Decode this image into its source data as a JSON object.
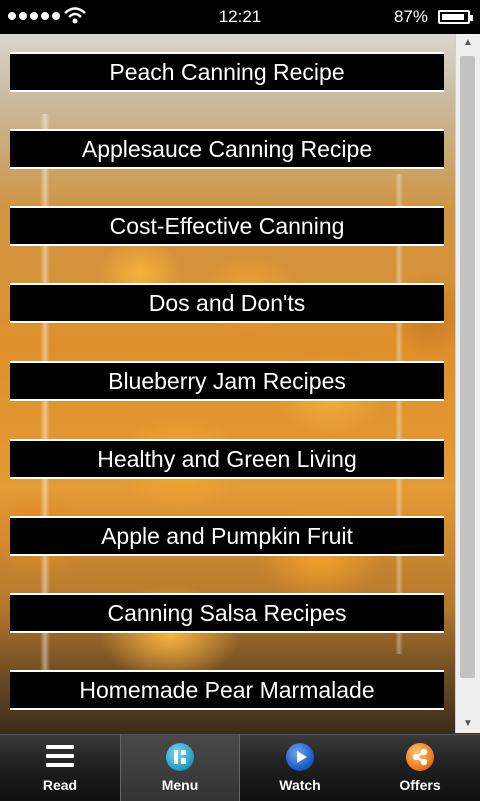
{
  "status_bar": {
    "time": "12:21",
    "battery_percent": "87%",
    "signal_icon": "signal-dots-icon",
    "wifi_icon": "wifi-icon",
    "battery_icon": "battery-icon"
  },
  "menu": {
    "items": [
      {
        "label": "Peach Canning Recipe"
      },
      {
        "label": "Applesauce Canning Recipe"
      },
      {
        "label": "Cost-Effective Canning"
      },
      {
        "label": "Dos and Don'ts"
      },
      {
        "label": "Blueberry Jam Recipes"
      },
      {
        "label": "Healthy and Green Living"
      },
      {
        "label": "Apple and Pumpkin Fruit"
      },
      {
        "label": "Canning Salsa Recipes"
      },
      {
        "label": "Homemade Pear Marmalade"
      }
    ]
  },
  "tabs": [
    {
      "label": "Read",
      "icon": "hamburger-icon"
    },
    {
      "label": "Menu",
      "icon": "menu-grid-icon"
    },
    {
      "label": "Watch",
      "icon": "play-icon"
    },
    {
      "label": "Offers",
      "icon": "share-icon"
    }
  ],
  "colors": {
    "tab_menu_icon": "#2aa6c9",
    "tab_watch_icon": "#1f62c8",
    "tab_offers_icon": "#ef7f1a"
  }
}
